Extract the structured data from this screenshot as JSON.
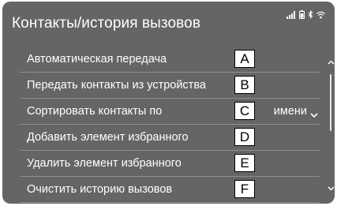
{
  "header": {
    "title": "Контакты/история вызовов",
    "status_icons": [
      "signal-icon",
      "battery-icon",
      "bluetooth-icon",
      "wifi-icon"
    ]
  },
  "menu": {
    "items": [
      {
        "label": "Автоматическая передача",
        "tag": "A"
      },
      {
        "label": "Передать контакты из устройства",
        "tag": "B"
      },
      {
        "label": "Сортировать контакты по",
        "tag": "C",
        "value": "имени"
      },
      {
        "label": "Добавить элемент избранного",
        "tag": "D"
      },
      {
        "label": "Удалить элемент избранного",
        "tag": "E"
      },
      {
        "label": "Очистить историю вызовов",
        "tag": "F"
      }
    ]
  },
  "colors": {
    "screen_bg": "#656565",
    "text": "#ffffff",
    "divider": "#8e8e8e"
  }
}
